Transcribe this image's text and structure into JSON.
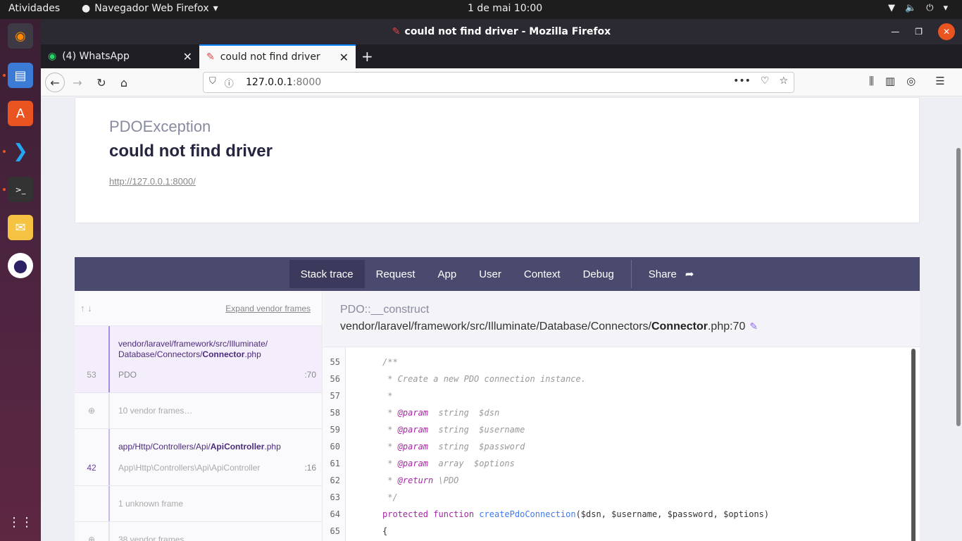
{
  "topbar": {
    "activities": "Atividades",
    "app_name": "Navegador Web Firefox",
    "clock": "1 de mai  10:00"
  },
  "window": {
    "title": "could not find driver - Mozilla Firefox"
  },
  "tabs": [
    {
      "label": "(4) WhatsApp"
    },
    {
      "label": "could not find driver"
    }
  ],
  "urlbar": {
    "host": "127.0.0.1",
    "port": ":8000"
  },
  "error": {
    "exception_class": "PDOException",
    "message": "could not find driver",
    "url": "http://127.0.0.1:8000/"
  },
  "section_tabs": [
    "Stack trace",
    "Request",
    "App",
    "User",
    "Context",
    "Debug"
  ],
  "share_label": "Share",
  "frames_panel": {
    "expand_label": "Expand vendor frames",
    "frames": [
      {
        "number": "53",
        "path_prefix": "vendor/laravel/framework/src/Illuminate/\nDatabase/Connectors/",
        "path_file": "Connector",
        "path_ext": ".php",
        "class": "PDO",
        "line": ":70"
      },
      {
        "label": "10 vendor frames…"
      },
      {
        "number": "42",
        "path_prefix": "app/Http/Controllers/Api/",
        "path_file": "ApiController",
        "path_ext": ".php",
        "class": "App\\Http\\Controllers\\Api\\ApiController",
        "line": ":16"
      },
      {
        "label": "1 unknown frame"
      },
      {
        "label": "38 vendor frames…"
      }
    ]
  },
  "detail": {
    "function": "PDO::__construct",
    "file_prefix": "vendor/laravel/framework/src/Illuminate/Database/Connectors/",
    "file_name": "Connector",
    "file_suffix": ".php:70"
  },
  "code_lines": [
    {
      "n": "55",
      "text": "/**"
    },
    {
      "n": "56",
      "text": " * Create a new PDO connection instance."
    },
    {
      "n": "57",
      "text": " *"
    },
    {
      "n": "58",
      "tag": "@param",
      "text": "  string  $dsn"
    },
    {
      "n": "59",
      "tag": "@param",
      "text": "  string  $username"
    },
    {
      "n": "60",
      "tag": "@param",
      "text": "  string  $password"
    },
    {
      "n": "61",
      "tag": "@param",
      "text": "  array  $options"
    },
    {
      "n": "62",
      "tag": "@return",
      "text": " \\PDO"
    },
    {
      "n": "63",
      "text": " */"
    },
    {
      "n": "64",
      "kw1": "protected",
      "kw2": "function",
      "fn": "createPdoConnection",
      "text": "($dsn, $username, $password, $options)"
    },
    {
      "n": "65",
      "text": "{"
    }
  ],
  "colors": {
    "accent": "#0a84ff",
    "ignition_nav": "#4a4a6e",
    "frame_link": "#4b2a7a",
    "close_button": "#e95420"
  }
}
